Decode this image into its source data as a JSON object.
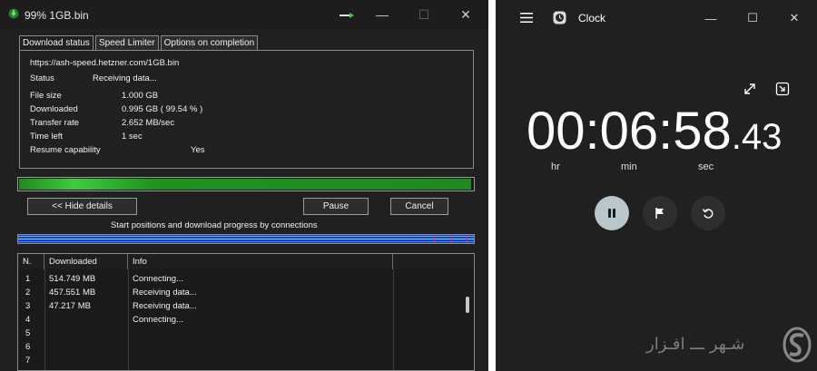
{
  "download_window": {
    "title": "99% 1GB.bin",
    "tabs": [
      "Download status",
      "Speed Limiter",
      "Options on completion"
    ],
    "url": "https://ash-speed.hetzner.com/1GB.bin",
    "status_label": "Status",
    "status_value": "Receiving data...",
    "details": [
      {
        "label": "File size",
        "value": "1.000  GB"
      },
      {
        "label": "Downloaded",
        "value": "0.995  GB  ( 99.54 % )"
      },
      {
        "label": "Transfer rate",
        "value": "2.652  MB/sec"
      },
      {
        "label": "Time left",
        "value": "1 sec"
      },
      {
        "label": "Resume capability",
        "value": "Yes"
      }
    ],
    "progress_percent": 99.54,
    "buttons": {
      "hide_details": "<< Hide details",
      "pause": "Pause",
      "cancel": "Cancel"
    },
    "connections_caption": "Start positions and download progress by connections",
    "table": {
      "columns": [
        "N.",
        "Downloaded",
        "Info"
      ],
      "rows": [
        {
          "n": "1",
          "downloaded": "514.749  MB",
          "info": "Connecting..."
        },
        {
          "n": "2",
          "downloaded": "457.551  MB",
          "info": "Receiving data..."
        },
        {
          "n": "3",
          "downloaded": "47.217  MB",
          "info": "Receiving data..."
        },
        {
          "n": "4",
          "downloaded": "",
          "info": "Connecting..."
        },
        {
          "n": "5",
          "downloaded": "",
          "info": ""
        },
        {
          "n": "6",
          "downloaded": "",
          "info": ""
        },
        {
          "n": "7",
          "downloaded": "",
          "info": ""
        }
      ]
    },
    "window_controls": {
      "minimize": "—",
      "maximize": "☐",
      "close": "✕"
    }
  },
  "clock_window": {
    "title": "Clock",
    "time_main": "00:06:58",
    "time_fraction": ".43",
    "units": {
      "hr": "hr",
      "min": "min",
      "sec": "sec"
    },
    "window_controls": {
      "minimize": "—",
      "maximize": "☐",
      "close": "✕"
    },
    "accent_button_color": "#b9c7cc"
  },
  "watermark": {
    "text": "شـهر‌ ـــ افـزار"
  }
}
